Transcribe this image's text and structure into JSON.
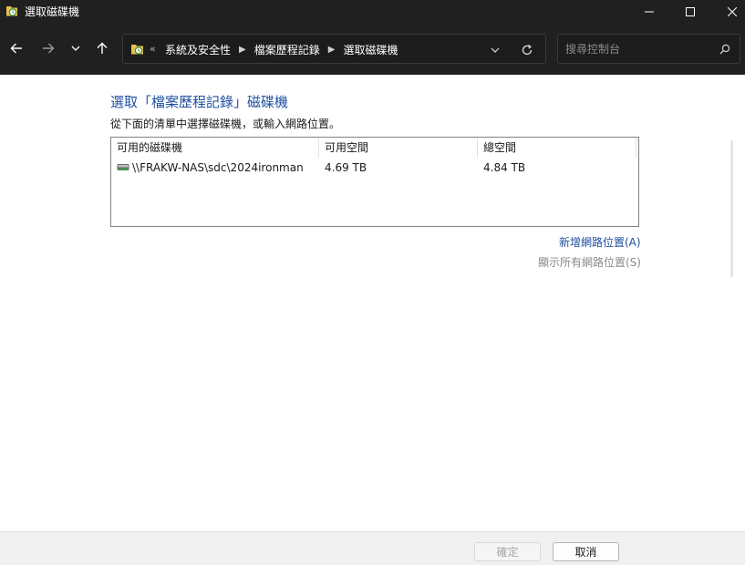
{
  "window": {
    "title": "選取磁碟機",
    "icon": "file-history-icon"
  },
  "nav": {
    "address_overflow": "«",
    "breadcrumbs": [
      "系統及安全性",
      "檔案歷程記錄",
      "選取磁碟機"
    ],
    "search_placeholder": "搜尋控制台"
  },
  "main": {
    "heading": "選取「檔案歷程記錄」磁碟機",
    "instruction": "從下面的清單中選擇磁碟機，或輸入網路位置。",
    "columns": [
      "可用的磁碟機",
      "可用空間",
      "總空間"
    ],
    "drives": [
      {
        "name": "\\\\FRAKW-NAS\\sdc\\2024ironman",
        "free": "4.69 TB",
        "total": "4.84 TB",
        "icon": "network-drive-icon"
      }
    ],
    "add_network_location": "新增網路位置(A)",
    "show_all_network_locations": "顯示所有網路位置(S)"
  },
  "footer": {
    "ok_label": "確定",
    "cancel_label": "取消"
  },
  "colors": {
    "titlebar_bg": "#202020",
    "accent_link": "#1e4e9e"
  }
}
